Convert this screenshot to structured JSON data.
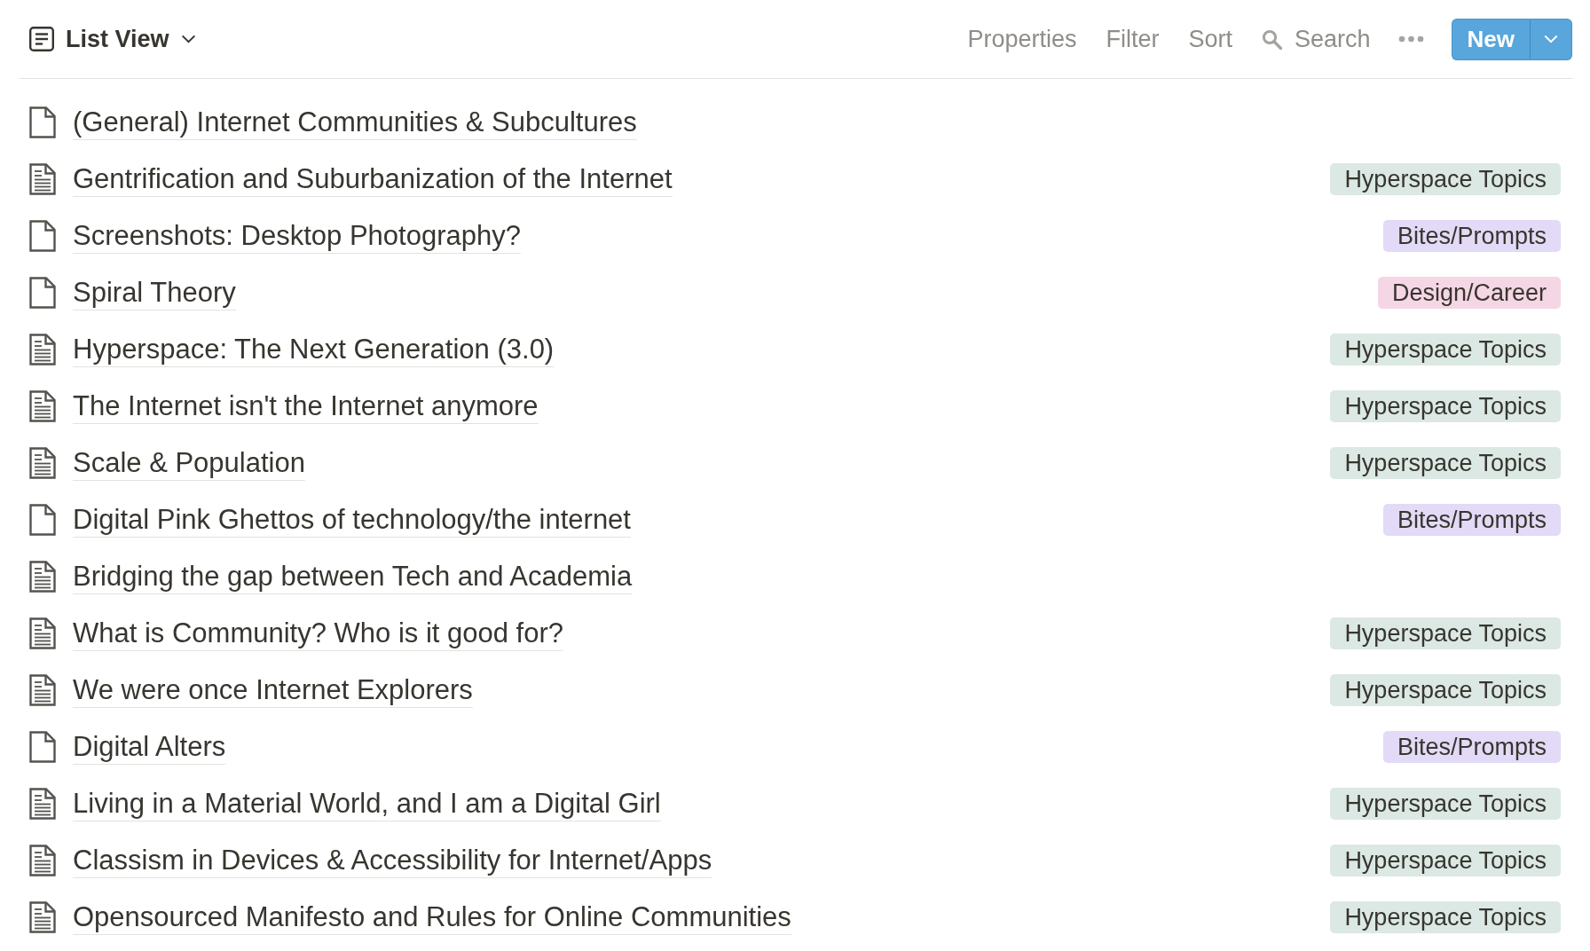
{
  "view": {
    "title": "List View"
  },
  "toolbar": {
    "items": [
      "Properties",
      "Filter",
      "Sort"
    ],
    "search": "Search",
    "new_button": "New"
  },
  "pages": [
    {
      "title": "(General) Internet Communities & Subcultures",
      "kind": "blank"
    },
    {
      "title": "Gentrification and Suburbanization of the Internet",
      "kind": "text",
      "tag": {
        "label": "Hyperspace Topics",
        "color": "#dbe8e3"
      }
    },
    {
      "title": "Screenshots: Desktop Photography?",
      "kind": "blank",
      "tag": {
        "label": "Bites/Prompts",
        "color": "#e2daf6"
      }
    },
    {
      "title": "Spiral Theory",
      "kind": "blank",
      "tag": {
        "label": "Design/Career",
        "color": "#f5d6e5"
      }
    },
    {
      "title": "Hyperspace: The Next Generation (3.0)",
      "kind": "text",
      "tag": {
        "label": "Hyperspace Topics",
        "color": "#dbe8e3"
      }
    },
    {
      "title": "The Internet isn't the Internet anymore",
      "kind": "text",
      "tag": {
        "label": "Hyperspace Topics",
        "color": "#dbe8e3"
      }
    },
    {
      "title": "Scale & Population",
      "kind": "text",
      "tag": {
        "label": "Hyperspace Topics",
        "color": "#dbe8e3"
      }
    },
    {
      "title": "Digital Pink Ghettos of technology/the internet",
      "kind": "blank",
      "tag": {
        "label": "Bites/Prompts",
        "color": "#e2daf6"
      }
    },
    {
      "title": "Bridging the gap between Tech and Academia",
      "kind": "text"
    },
    {
      "title": "What is Community? Who is it good for?",
      "kind": "text",
      "tag": {
        "label": "Hyperspace Topics",
        "color": "#dbe8e3"
      }
    },
    {
      "title": "We were once Internet Explorers",
      "kind": "text",
      "tag": {
        "label": "Hyperspace Topics",
        "color": "#dbe8e3"
      }
    },
    {
      "title": "Digital Alters",
      "kind": "blank",
      "tag": {
        "label": "Bites/Prompts",
        "color": "#e2daf6"
      }
    },
    {
      "title": "Living in a Material World, and I am a Digital Girl",
      "kind": "text",
      "tag": {
        "label": "Hyperspace Topics",
        "color": "#dbe8e3"
      }
    },
    {
      "title": "Classism in Devices & Accessibility for Internet/Apps",
      "kind": "text",
      "tag": {
        "label": "Hyperspace Topics",
        "color": "#dbe8e3"
      }
    },
    {
      "title": "Opensourced Manifesto and Rules for Online Communities",
      "kind": "text",
      "tag": {
        "label": "Hyperspace Topics",
        "color": "#dbe8e3"
      }
    }
  ]
}
